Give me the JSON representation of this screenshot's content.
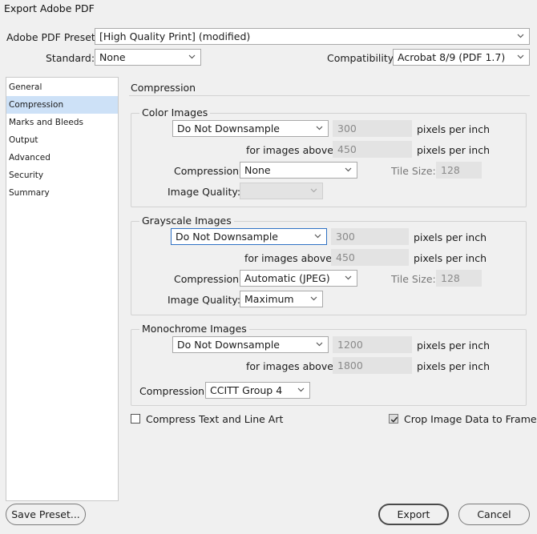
{
  "window": {
    "title": "Export Adobe PDF"
  },
  "top": {
    "preset_label": "Adobe PDF Preset:",
    "preset_value": "[High Quality Print] (modified)",
    "standard_label": "Standard:",
    "standard_value": "None",
    "compat_label": "Compatibility:",
    "compat_value": "Acrobat 8/9 (PDF 1.7)"
  },
  "sidebar": {
    "items": [
      {
        "label": "General"
      },
      {
        "label": "Compression"
      },
      {
        "label": "Marks and Bleeds"
      },
      {
        "label": "Output"
      },
      {
        "label": "Advanced"
      },
      {
        "label": "Security"
      },
      {
        "label": "Summary"
      }
    ],
    "selected": "Compression"
  },
  "panel": {
    "heading": "Compression",
    "color": {
      "title": "Color Images",
      "downsample": "Do Not Downsample",
      "ppi": "300",
      "ppi_unit": "pixels per inch",
      "above_label": "for images above:",
      "above_value": "450",
      "above_unit": "pixels per inch",
      "compression_label": "Compression:",
      "compression_value": "None",
      "tile_label": "Tile Size:",
      "tile_value": "128",
      "quality_label": "Image Quality:",
      "quality_value": ""
    },
    "gray": {
      "title": "Grayscale Images",
      "downsample": "Do Not Downsample",
      "ppi": "300",
      "ppi_unit": "pixels per inch",
      "above_label": "for images above:",
      "above_value": "450",
      "above_unit": "pixels per inch",
      "compression_label": "Compression:",
      "compression_value": "Automatic (JPEG)",
      "tile_label": "Tile Size:",
      "tile_value": "128",
      "quality_label": "Image Quality:",
      "quality_value": "Maximum"
    },
    "mono": {
      "title": "Monochrome Images",
      "downsample": "Do Not Downsample",
      "ppi": "1200",
      "ppi_unit": "pixels per inch",
      "above_label": "for images above:",
      "above_value": "1800",
      "above_unit": "pixels per inch",
      "compression_label": "Compression:",
      "compression_value": "CCITT Group 4"
    },
    "compress_text": {
      "label": "Compress Text and Line Art",
      "checked": false
    },
    "crop_image": {
      "label": "Crop Image Data to Frames",
      "checked": true
    }
  },
  "buttons": {
    "save_preset": "Save Preset...",
    "export": "Export",
    "cancel": "Cancel"
  }
}
